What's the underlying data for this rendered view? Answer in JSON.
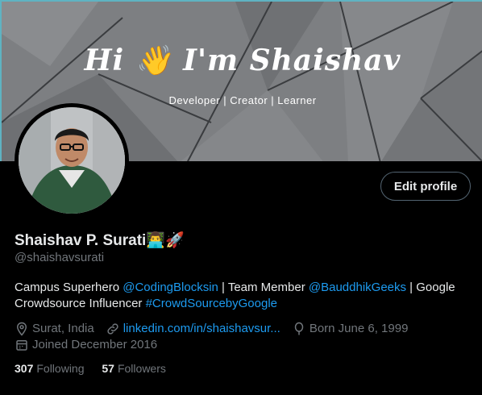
{
  "banner": {
    "greeting": "Hi 👋 I'm Shaishav",
    "tagline": "Developer | Creator | Learner"
  },
  "profile": {
    "display_name": "Shaishav P. Surati",
    "name_emojis": "👨‍💻🚀",
    "handle": "@shaishavsurati",
    "edit_button": "Edit profile"
  },
  "bio": {
    "part1": "Campus Superhero ",
    "mention1": "@CodingBlocksin",
    "part2": " | Team Member ",
    "mention2": "@BauddhikGeeks",
    "part3": " | Google Crowdsource Influencer ",
    "hashtag": "#CrowdSourcebyGoogle"
  },
  "meta": {
    "location": "Surat, India",
    "website": "linkedin.com/in/shaishavsur...",
    "birthday": "Born June 6, 1999",
    "joined": "Joined December 2016"
  },
  "stats": {
    "following_count": "307",
    "following_label": "Following",
    "followers_count": "57",
    "followers_label": "Followers"
  },
  "colors": {
    "background": "#000000",
    "link": "#1d9bf0",
    "muted": "#71767b",
    "text": "#e7e9ea"
  },
  "icons": [
    "location-icon",
    "link-icon",
    "balloon-icon",
    "calendar-icon"
  ]
}
